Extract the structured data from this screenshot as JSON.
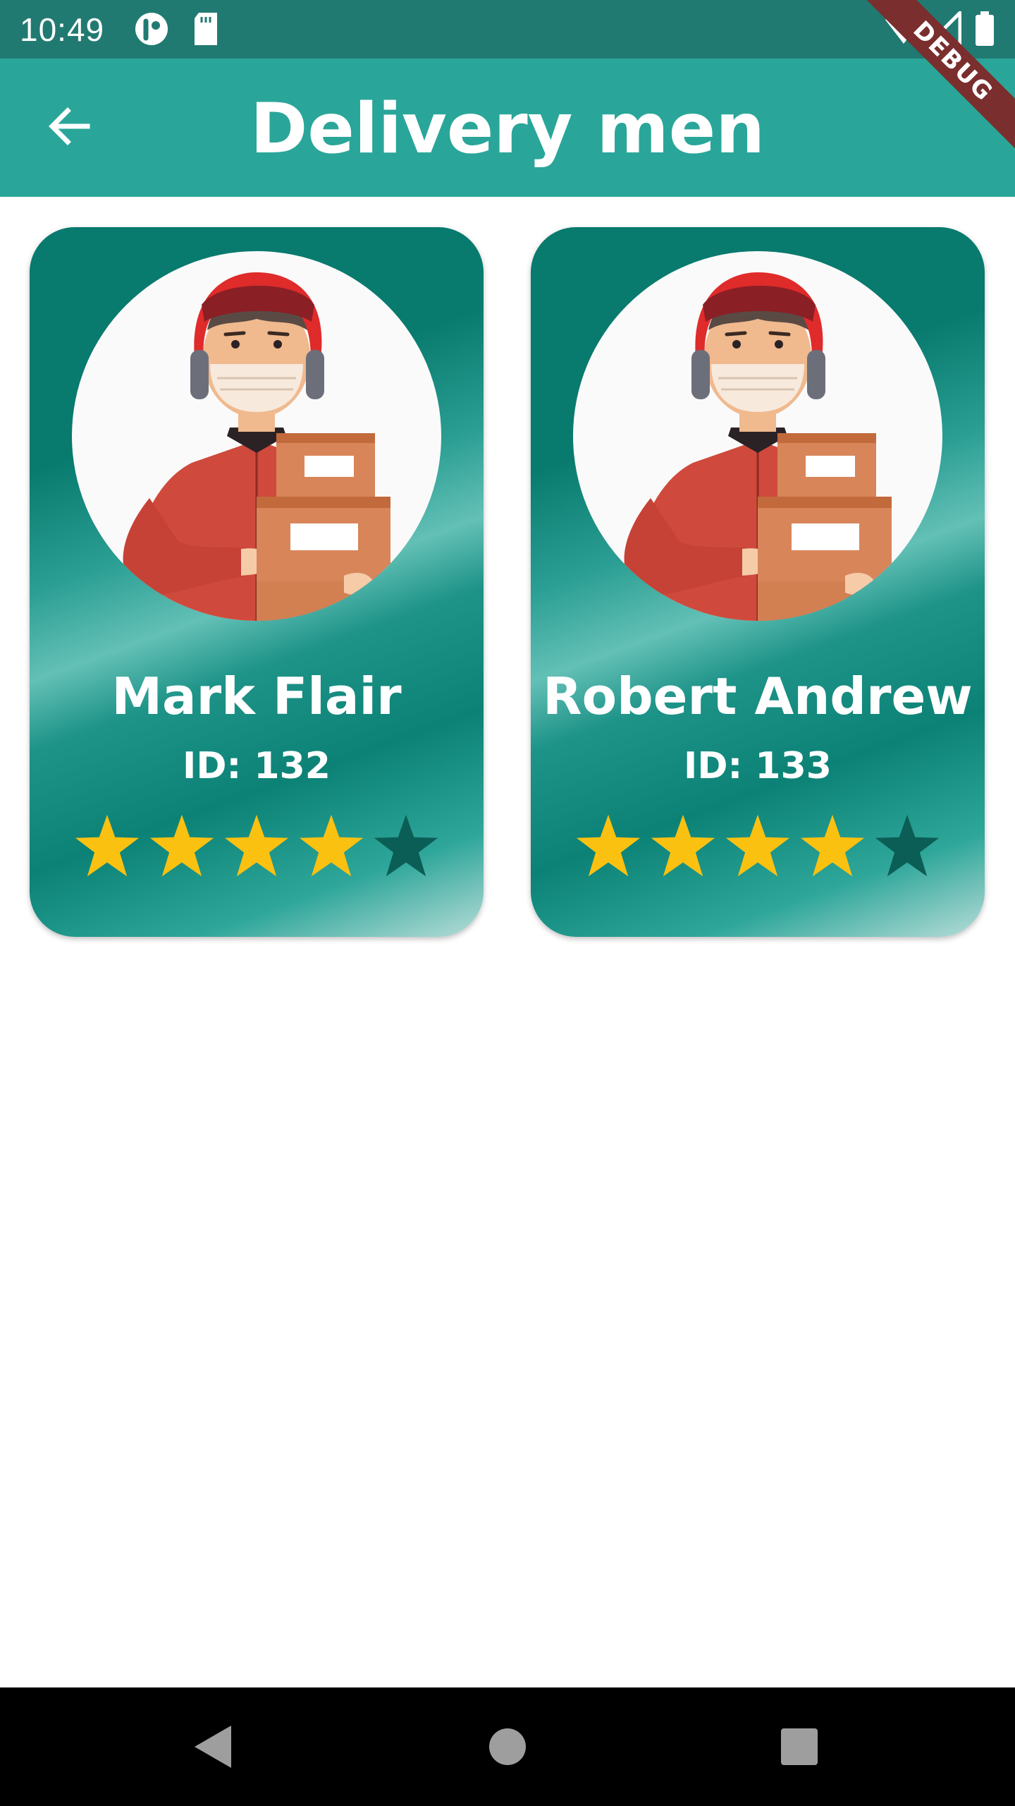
{
  "status_bar": {
    "time": "10:49",
    "icons": [
      "app-notification-icon",
      "sd-card-icon",
      "wifi-icon",
      "signal-icon",
      "battery-icon"
    ]
  },
  "app_bar": {
    "title": "Delivery men",
    "back_icon": "arrow-back-icon",
    "background": "#29a699"
  },
  "debug_banner": "DEBUG",
  "delivery_men": [
    {
      "name": "Mark Flair",
      "id": "ID: 132",
      "rating": 4,
      "max_rating": 5
    },
    {
      "name": "Robert Andrew",
      "id": "ID: 133",
      "rating": 4,
      "max_rating": 5
    }
  ],
  "colors": {
    "accent": "#29a699",
    "star_filled": "#fbc111",
    "star_empty": "#0b5e55"
  },
  "nav_bar": {
    "icons": [
      "back-triangle-icon",
      "home-circle-icon",
      "recents-square-icon"
    ]
  }
}
